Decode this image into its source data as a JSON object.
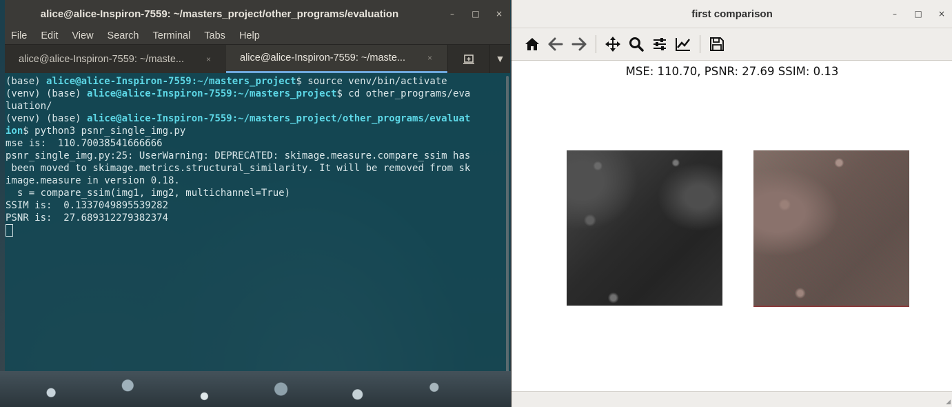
{
  "terminal": {
    "title": "alice@alice-Inspiron-7559: ~/masters_project/other_programs/evaluation",
    "window_buttons": [
      "–",
      "□",
      "×"
    ],
    "menu": [
      "File",
      "Edit",
      "View",
      "Search",
      "Terminal",
      "Tabs",
      "Help"
    ],
    "tabs": [
      {
        "label": "alice@alice-Inspiron-7559: ~/maste...",
        "close": "×"
      },
      {
        "label": "alice@alice-Inspiron-7559: ~/maste...",
        "close": "×"
      }
    ],
    "lines": [
      {
        "pre": "(base) ",
        "user": "alice@alice-Inspiron-7559",
        "path": ":~/masters_project",
        "post": "$ source venv/bin/activate"
      },
      {
        "pre": "(venv) (base) ",
        "user": "alice@alice-Inspiron-7559",
        "path": ":~/masters_project",
        "post": "$ cd other_programs/eva"
      },
      {
        "text": "luation/"
      },
      {
        "pre": "(venv) (base) ",
        "user": "alice@alice-Inspiron-7559",
        "path": ":~/masters_project/other_programs/evaluat",
        "post": ""
      },
      {
        "path2": "ion",
        "post": "$ python3 psnr_single_img.py"
      },
      {
        "text": "mse is:  110.70038541666666"
      },
      {
        "text": "psnr_single_img.py:25: UserWarning: DEPRECATED: skimage.measure.compare_ssim has"
      },
      {
        "text": " been moved to skimage.metrics.structural_similarity. It will be removed from sk"
      },
      {
        "text": "image.measure in version 0.18."
      },
      {
        "text": "  s = compare_ssim(img1, img2, multichannel=True)"
      },
      {
        "text": "SSIM is:  0.1337049895539282"
      },
      {
        "text": "PSNR is:  27.689312279382374"
      }
    ]
  },
  "figure": {
    "title": "first comparison",
    "window_buttons": [
      "–",
      "□",
      "×"
    ],
    "toolbar": [
      "home-icon",
      "back-arrow-icon",
      "forward-arrow-icon",
      "pan-icon",
      "zoom-icon",
      "configure-subplots-icon",
      "edit-axis-icon",
      "save-icon"
    ],
    "heading": "MSE: 110.70, PSNR: 27.69 SSIM: 0.13"
  }
}
